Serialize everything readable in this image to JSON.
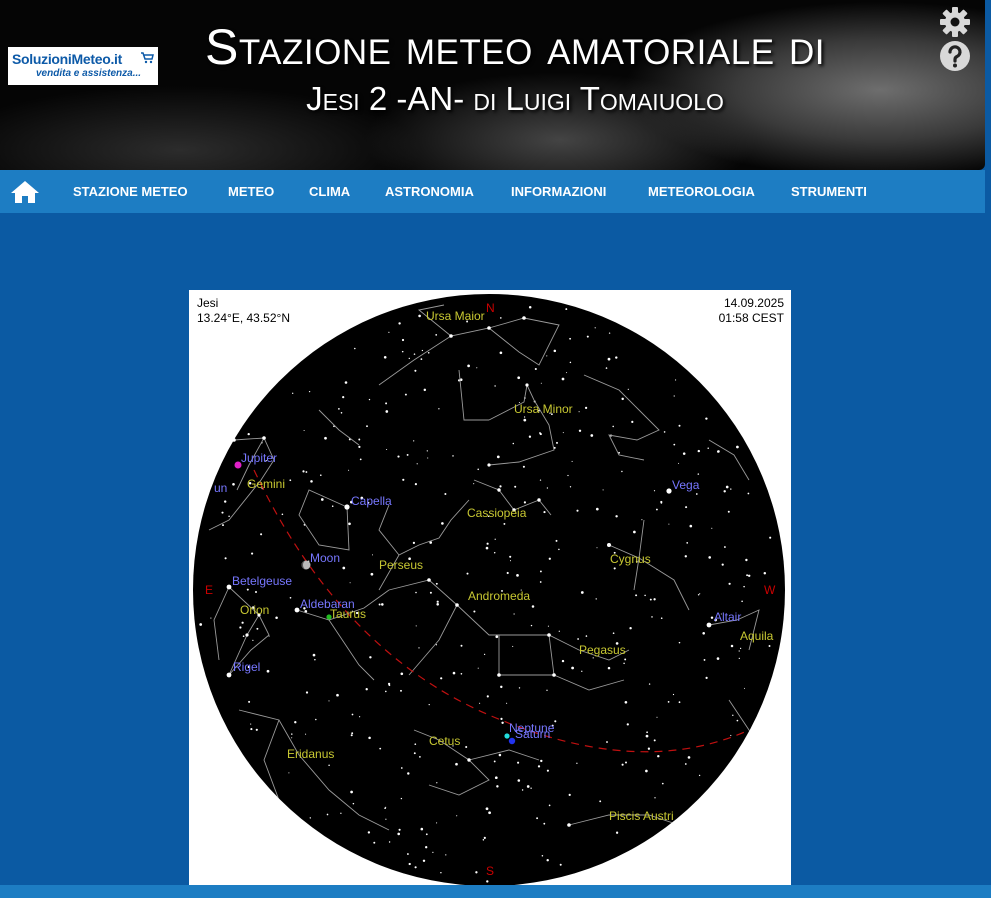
{
  "header": {
    "logo_brand": "SoluzioniMeteo.it",
    "logo_tagline": "vendita e assistenza...",
    "title_line1": "Stazione meteo amatoriale di",
    "title_line2": "Jesi 2 -AN- di Luigi Tomaiuolo"
  },
  "nav": {
    "items": [
      "STAZIONE METEO",
      "METEO",
      "CLIMA",
      "ASTRONOMIA",
      "INFORMAZIONI",
      "METEOROLOGIA",
      "STRUMENTI"
    ]
  },
  "sky": {
    "location_name": "Jesi",
    "coordinates": "13.24°E, 43.52°N",
    "date": "14.09.2025",
    "time": "01:58 CEST",
    "directions": {
      "north": "N",
      "east": "E",
      "west": "W",
      "south": "S"
    },
    "constellations": [
      "Ursa Maior",
      "Ursa Minor",
      "Gemini",
      "Cassiopeia",
      "Perseus",
      "Cygnus",
      "Andromeda",
      "Orion",
      "Taurus",
      "Pegasus",
      "Aquila",
      "Cetus",
      "Eridanus",
      "Piscis Austri"
    ],
    "stars": [
      "Capella",
      "Vega",
      "Betelgeuse",
      "Aldebaran",
      "Rigel",
      "Altair"
    ],
    "planets": [
      "Jupiter",
      "Moon",
      "Neptune",
      "Saturn",
      "un"
    ],
    "colors": {
      "sky": "#000000",
      "constellation_label": "#c8c832",
      "star_label": "#7777ff",
      "lines": "#aaaaaa",
      "horizon_marks": "#cc0000"
    }
  }
}
